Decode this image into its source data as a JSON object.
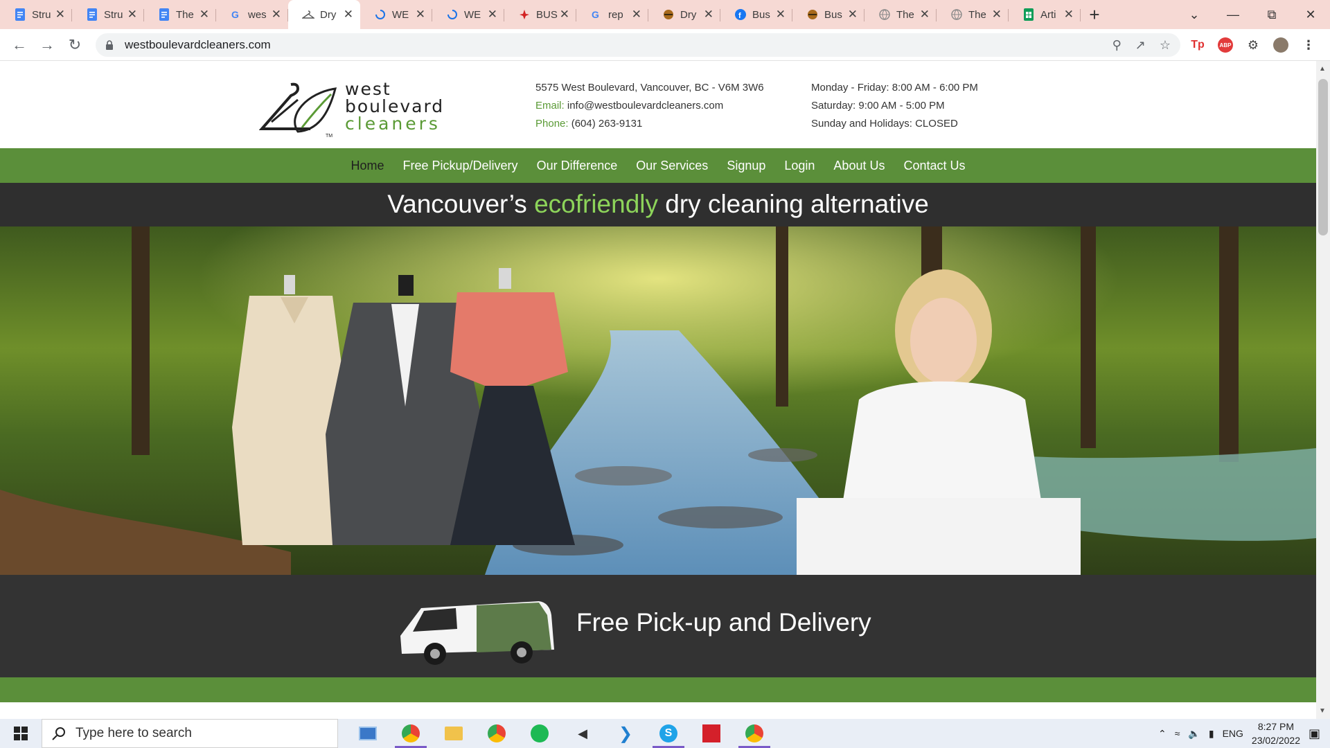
{
  "browser": {
    "tabs": [
      {
        "title": "Stru",
        "icon": "google-docs-icon",
        "active": false
      },
      {
        "title": "Stru",
        "icon": "google-docs-icon",
        "active": false
      },
      {
        "title": "The",
        "icon": "google-docs-icon",
        "active": false
      },
      {
        "title": "wes",
        "icon": "google-icon",
        "active": false
      },
      {
        "title": "Dry",
        "icon": "hanger-icon",
        "active": true
      },
      {
        "title": "WE",
        "icon": "loading-icon",
        "active": false
      },
      {
        "title": "WE",
        "icon": "loading-icon",
        "active": false
      },
      {
        "title": "BUS",
        "icon": "yelp-icon",
        "active": false
      },
      {
        "title": "rep",
        "icon": "google-icon",
        "active": false
      },
      {
        "title": "Dry",
        "icon": "burger-icon",
        "active": false
      },
      {
        "title": "Bus",
        "icon": "facebook-icon",
        "active": false
      },
      {
        "title": "Bus",
        "icon": "burger-icon",
        "active": false
      },
      {
        "title": "The",
        "icon": "globe-icon",
        "active": false
      },
      {
        "title": "The",
        "icon": "globe-icon",
        "active": false
      },
      {
        "title": "Arti",
        "icon": "google-sheets-icon",
        "active": false
      }
    ],
    "url": "westboulevardcleaners.com"
  },
  "site": {
    "logo": {
      "line1": "west",
      "line2": "boulevard",
      "line3": "cleaners",
      "tm": "TM"
    },
    "address": "5575 West Boulevard, Vancouver, BC - V6M 3W6",
    "email_label": "Email:",
    "email": "info@westboulevardcleaners.com",
    "phone_label": "Phone:",
    "phone": "(604) 263-9131",
    "hours": [
      "Monday - Friday: 8:00 AM - 6:00 PM",
      "Saturday: 9:00 AM - 5:00 PM",
      "Sunday and Holidays: CLOSED"
    ],
    "nav": [
      "Home",
      "Free Pickup/Delivery",
      "Our Difference",
      "Our Services",
      "Signup",
      "Login",
      "About Us",
      "Contact Us"
    ],
    "tagline_pre": "Vancouver’s",
    "tagline_eco": "ecofriendly",
    "tagline_post": "dry cleaning alternative",
    "delivery_title": "Free Pick-up and Delivery",
    "colors": {
      "brand_green": "#5b8f3a",
      "eco_green": "#8dd45a",
      "dark_band": "#2f2f2f"
    }
  },
  "taskbar": {
    "search_placeholder": "Type here to search",
    "language": "ENG",
    "time": "8:27 PM",
    "date": "23/02/2022"
  }
}
